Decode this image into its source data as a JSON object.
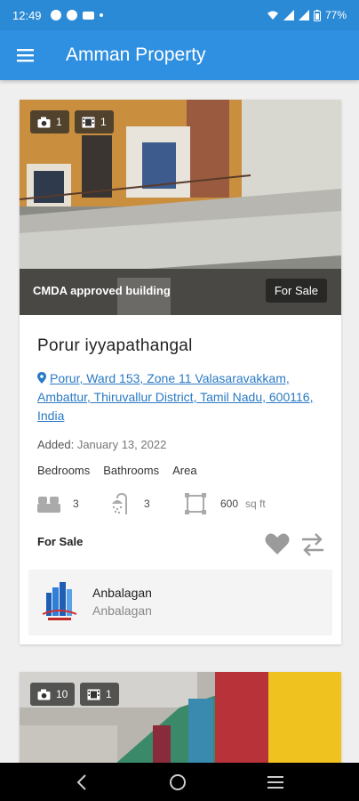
{
  "status_bar": {
    "time": "12:49",
    "battery": "77%"
  },
  "app_bar": {
    "title": "Amman Property",
    "menu_icon": "hamburger-menu-icon",
    "background": "#2f8fe0"
  },
  "listings": [
    {
      "photo_count": "1",
      "video_count": "1",
      "caption": "CMDA approved building",
      "status_tag": "For Sale",
      "title": "Porur iyyapathangal",
      "address": "Porur, Ward 153, Zone 11 Valasaravakkam, Ambattur, Thiruvallur District, Tamil Nadu, 600116, India",
      "added_label": "Added:",
      "added_date": "January 13, 2022",
      "feature_labels": {
        "bedrooms": "Bedrooms",
        "bathrooms": "Bathrooms",
        "area": "Area"
      },
      "bedrooms": "3",
      "bathrooms": "3",
      "area": "600",
      "area_unit": "sq ft",
      "sale_label": "For Sale",
      "agent": {
        "name": "Anbalagan",
        "subtitle": "Anbalagan"
      }
    },
    {
      "photo_count": "10",
      "video_count": "1"
    }
  ],
  "colors": {
    "accent": "#2f8fe0",
    "link": "#2a7ac4"
  },
  "icons": [
    "camera-icon",
    "video-icon",
    "location-pin-icon",
    "bed-icon",
    "shower-icon",
    "area-icon",
    "heart-icon",
    "compare-icon",
    "back-icon",
    "home-icon",
    "recents-icon"
  ]
}
